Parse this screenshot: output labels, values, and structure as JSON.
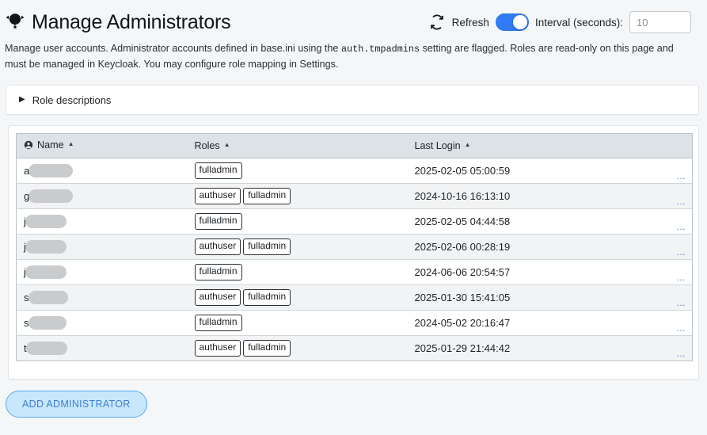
{
  "header": {
    "title": "Manage Administrators",
    "title_icon": "admin-person-icon",
    "refresh_icon": "refresh-circular-arrows-icon",
    "refresh_label": "Refresh",
    "refresh_enabled": true,
    "interval_label": "Interval (seconds):",
    "interval_value": "",
    "interval_placeholder": "10"
  },
  "description": {
    "part1": "Manage user accounts. Administrator accounts defined in base.ini using the ",
    "code": "auth.tmpadmins",
    "part2": " setting are flagged. Roles are read-only on this page and must be managed in Keycloak. You may configure role mapping in Settings."
  },
  "accordion": {
    "arrow": "▶",
    "label": "Role descriptions",
    "expanded": false
  },
  "table": {
    "columns": [
      {
        "label": "Name",
        "icon": "user-circle-icon",
        "sort": "▲"
      },
      {
        "label": "Roles",
        "icon": "",
        "sort": "▲"
      },
      {
        "label": "Last Login",
        "icon": "",
        "sort": "▲"
      }
    ],
    "row_menu_label": "...",
    "rows": [
      {
        "name_initial": "a",
        "redacted_width": 56,
        "roles": [
          "fulladmin"
        ],
        "last_login": "2025-02-05 05:00:59"
      },
      {
        "name_initial": "g",
        "redacted_width": 56,
        "roles": [
          "authuser",
          "fulladmin"
        ],
        "last_login": "2024-10-16 16:13:10"
      },
      {
        "name_initial": "j",
        "redacted_width": 52,
        "roles": [
          "fulladmin"
        ],
        "last_login": "2025-02-05 04:44:58"
      },
      {
        "name_initial": "j",
        "redacted_width": 52,
        "roles": [
          "authuser",
          "fulladmin"
        ],
        "last_login": "2025-02-06 00:28:19"
      },
      {
        "name_initial": "j",
        "redacted_width": 52,
        "roles": [
          "fulladmin"
        ],
        "last_login": "2024-06-06 20:54:57"
      },
      {
        "name_initial": "s",
        "redacted_width": 50,
        "roles": [
          "authuser",
          "fulladmin"
        ],
        "last_login": "2025-01-30 15:41:05"
      },
      {
        "name_initial": "s",
        "redacted_width": 48,
        "roles": [
          "fulladmin"
        ],
        "last_login": "2024-05-02 20:16:47"
      },
      {
        "name_initial": "t",
        "redacted_width": 52,
        "roles": [
          "authuser",
          "fulladmin"
        ],
        "last_login": "2025-01-29 21:44:42"
      }
    ]
  },
  "footer": {
    "add_button_label": "ADD ADMINISTRATOR"
  },
  "colors": {
    "page_bg": "#f4f6f8",
    "accent_blue": "#2f7cf6",
    "link_blue": "#3e7fe6",
    "table_header_bg": "#dde2e6",
    "row_alt_bg": "#f2f3f4",
    "add_button_bg": "#c9e7fb",
    "add_button_border": "#5aa7ee",
    "redaction_gray": "#c9cbcd"
  }
}
